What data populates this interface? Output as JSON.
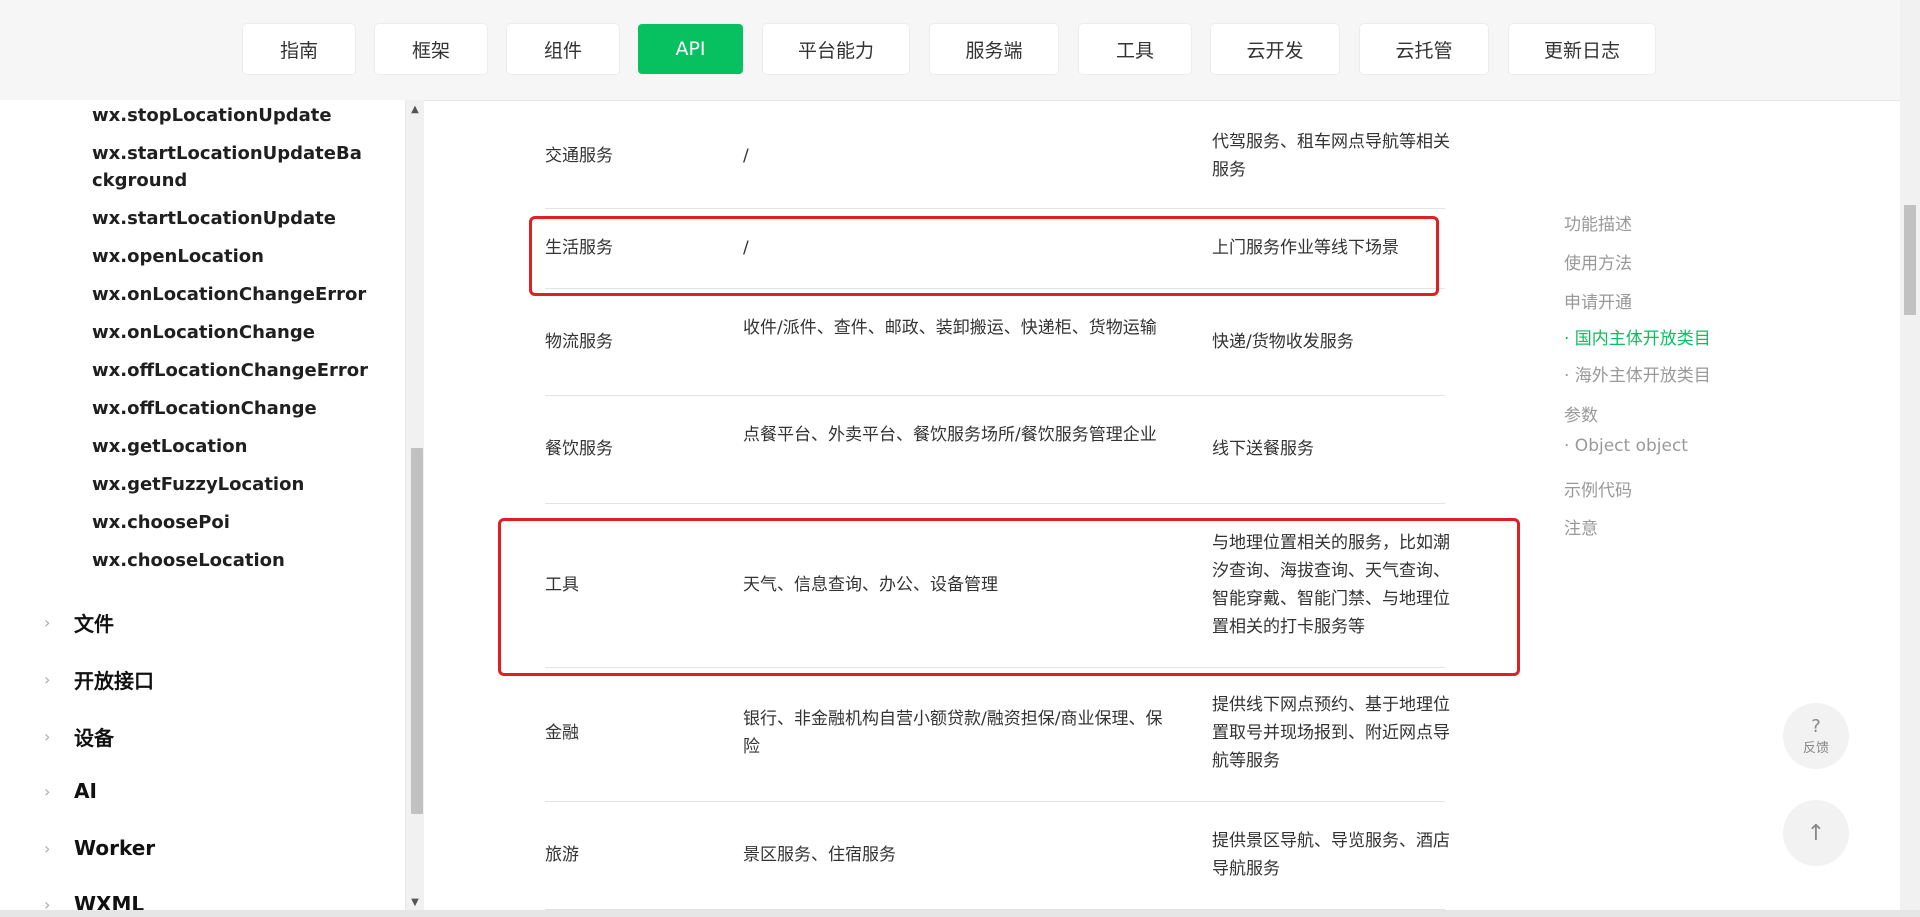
{
  "topnav": {
    "tabs": [
      "指南",
      "框架",
      "组件",
      "API",
      "平台能力",
      "服务端",
      "工具",
      "云开发",
      "云托管",
      "更新日志"
    ],
    "active": "API"
  },
  "sidebar": {
    "api_items": [
      "wx.stopLocationUpdate",
      "wx.startLocationUpdateBackground",
      "wx.startLocationUpdate",
      "wx.openLocation",
      "wx.onLocationChangeError",
      "wx.onLocationChange",
      "wx.offLocationChangeError",
      "wx.offLocationChange",
      "wx.getLocation",
      "wx.getFuzzyLocation",
      "wx.choosePoi",
      "wx.chooseLocation"
    ],
    "categories": [
      "文件",
      "开放接口",
      "设备",
      "AI",
      "Worker",
      "WXML"
    ]
  },
  "table": {
    "rows": [
      {
        "c1": "交通服务",
        "c2": "/",
        "c3": "代驾服务、租车网点导航等相关服务"
      },
      {
        "c1": "生活服务",
        "c2": "/",
        "c3": "上门服务作业等线下场景"
      },
      {
        "c1": "物流服务",
        "c2": "收件/派件、查件、邮政、装卸搬运、快递柜、货物运输",
        "c3": "快递/货物收发服务"
      },
      {
        "c1": "餐饮服务",
        "c2": "点餐平台、外卖平台、餐饮服务场所/餐饮服务管理企业",
        "c3": "线下送餐服务"
      },
      {
        "c1": "工具",
        "c2": "天气、信息查询、办公、设备管理",
        "c3": "与地理位置相关的服务，比如潮汐查询、海拔查询、天气查询、智能穿戴、智能门禁、与地理位置相关的打卡服务等"
      },
      {
        "c1": "金融",
        "c2": "银行、非金融机构自营小额贷款/融资担保/商业保理、保险",
        "c3": "提供线下网点预约、基于地理位置取号并现场报到、附近网点导航等服务"
      },
      {
        "c1": "旅游",
        "c2": "景区服务、住宿服务",
        "c3": "提供景区导航、导览服务、酒店导航服务"
      }
    ]
  },
  "toc": {
    "items": [
      "功能描述",
      "使用方法",
      "申请开通",
      "· 国内主体开放类目",
      "· 海外主体开放类目",
      "参数",
      "· Object object",
      "示例代码",
      "注意"
    ],
    "active_index": 3
  },
  "float": {
    "feedback_icon": "?",
    "feedback_label": "反馈",
    "top_icon": "↑"
  },
  "colors": {
    "accent": "#07c160",
    "highlight": "#e02020"
  }
}
